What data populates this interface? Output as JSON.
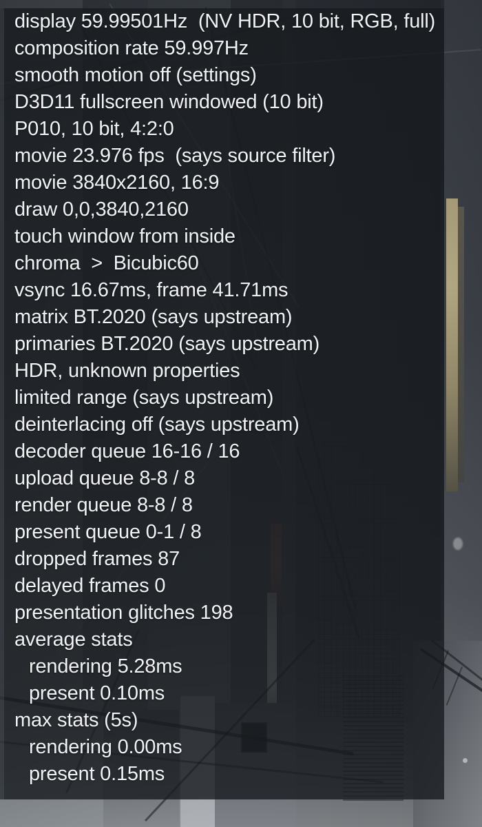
{
  "overlay": {
    "name": "video-renderer-stats-overlay",
    "text_color": "#f1f2f4",
    "panel_color": "#181b1f",
    "lines": [
      {
        "text": "display 59.99501Hz  (NV HDR, 10 bit, RGB, full)",
        "indent": false,
        "name": "stat-display-mode"
      },
      {
        "text": "composition rate 59.997Hz",
        "indent": false,
        "name": "stat-composition-rate"
      },
      {
        "text": "smooth motion off (settings)",
        "indent": false,
        "name": "stat-smooth-motion"
      },
      {
        "text": "D3D11 fullscreen windowed (10 bit)",
        "indent": false,
        "name": "stat-presentation-mode"
      },
      {
        "text": "P010, 10 bit, 4:2:0",
        "indent": false,
        "name": "stat-pixel-format"
      },
      {
        "text": "movie 23.976 fps  (says source filter)",
        "indent": false,
        "name": "stat-movie-fps"
      },
      {
        "text": "movie 3840x2160, 16:9",
        "indent": false,
        "name": "stat-movie-resolution"
      },
      {
        "text": "draw 0,0,3840,2160",
        "indent": false,
        "name": "stat-draw-rect"
      },
      {
        "text": "touch window from inside",
        "indent": false,
        "name": "stat-touch-window"
      },
      {
        "text": "chroma  >  Bicubic60",
        "indent": false,
        "name": "stat-chroma-scaler"
      },
      {
        "text": "vsync 16.67ms, frame 41.71ms",
        "indent": false,
        "name": "stat-vsync-frame"
      },
      {
        "text": "matrix BT.2020 (says upstream)",
        "indent": false,
        "name": "stat-matrix"
      },
      {
        "text": "primaries BT.2020 (says upstream)",
        "indent": false,
        "name": "stat-primaries"
      },
      {
        "text": "HDR, unknown properties",
        "indent": false,
        "name": "stat-hdr"
      },
      {
        "text": "limited range (says upstream)",
        "indent": false,
        "name": "stat-range"
      },
      {
        "text": "deinterlacing off (says upstream)",
        "indent": false,
        "name": "stat-deinterlacing"
      },
      {
        "text": "decoder queue 16-16 / 16",
        "indent": false,
        "name": "stat-decoder-queue"
      },
      {
        "text": "upload queue 8-8 / 8",
        "indent": false,
        "name": "stat-upload-queue"
      },
      {
        "text": "render queue 8-8 / 8",
        "indent": false,
        "name": "stat-render-queue"
      },
      {
        "text": "present queue 0-1 / 8",
        "indent": false,
        "name": "stat-present-queue"
      },
      {
        "text": "dropped frames 87",
        "indent": false,
        "name": "stat-dropped-frames"
      },
      {
        "text": "delayed frames 0",
        "indent": false,
        "name": "stat-delayed-frames"
      },
      {
        "text": "presentation glitches 198",
        "indent": false,
        "name": "stat-presentation-glitches"
      },
      {
        "text": "average stats",
        "indent": false,
        "name": "stat-average-stats-header"
      },
      {
        "text": "rendering 5.28ms",
        "indent": true,
        "name": "stat-average-rendering"
      },
      {
        "text": "present 0.10ms",
        "indent": true,
        "name": "stat-average-present"
      },
      {
        "text": "max stats (5s)",
        "indent": false,
        "name": "stat-max-stats-header"
      },
      {
        "text": "rendering 0.00ms",
        "indent": true,
        "name": "stat-max-rendering"
      },
      {
        "text": "present 0.15ms",
        "indent": true,
        "name": "stat-max-present"
      }
    ]
  },
  "background": {
    "name": "video-frame-night-alley",
    "description": "dark building facade at night with overhead wires"
  }
}
